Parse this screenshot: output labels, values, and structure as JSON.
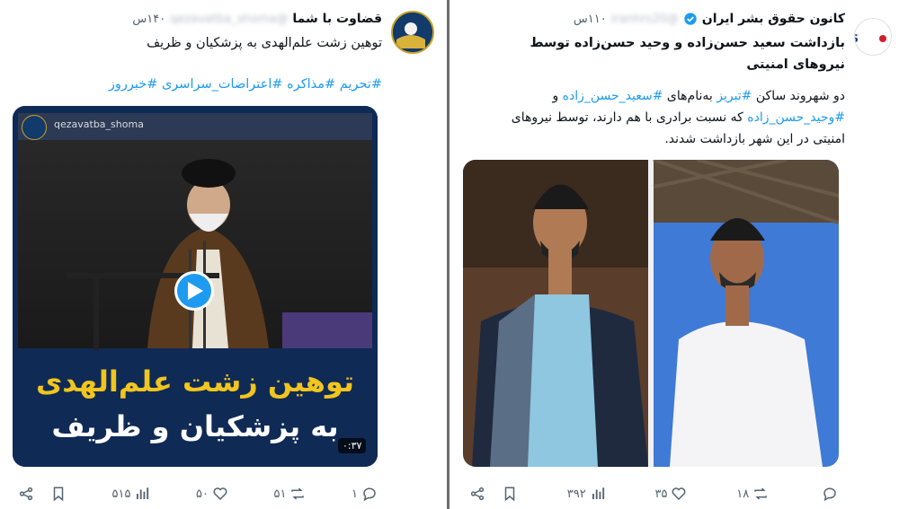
{
  "left_tweet": {
    "account_name": "قضاوت با شما",
    "handle": "@qezavatba_shoma",
    "time": "۱۴۰س",
    "text": "توهین زشت علم‌الهدی به پزشکیان و ظریف",
    "hashtags": "#تحریم #مذاکره #اعتراضات_سراسری #خبرروز",
    "video": {
      "watermark": "qezavatba_shoma",
      "caption_line1": "توهین زشت علم‌الهدی",
      "caption_line2": "به پزشکیان و ظریف",
      "duration": "۰:۳۷"
    },
    "stats": {
      "replies": "۱",
      "retweets": "۵۱",
      "likes": "۵۰",
      "views": "۵۱۵"
    }
  },
  "right_tweet": {
    "account_name": "کانون حقوق بشر ایران",
    "handle": "@iranhrs20",
    "time": "۱۱۰س",
    "title": "بازداشت سعید حسن‌زاده و وحید حسن‌زاده توسط نیروهای امنیتی",
    "body": {
      "part1": "دو شهروند ساکن ",
      "tag_city": "#تبریز",
      "part2": " به‌نام‌های ",
      "tag_1": "#سعید_حسن_زاده",
      "part3": " و ",
      "tag_2": "#وحید_حسن_زاده",
      "part4": " که نسبت برادری با هم دارند، توسط نیروهای امنیتی در این شهر بازداشت شدند."
    },
    "stats": {
      "replies": "",
      "retweets": "۱۸",
      "likes": "۳۵",
      "views": "۳۹۲"
    }
  },
  "colors": {
    "link": "#1d9bf0",
    "muted": "#536471",
    "verified": "#1d9bf0"
  }
}
